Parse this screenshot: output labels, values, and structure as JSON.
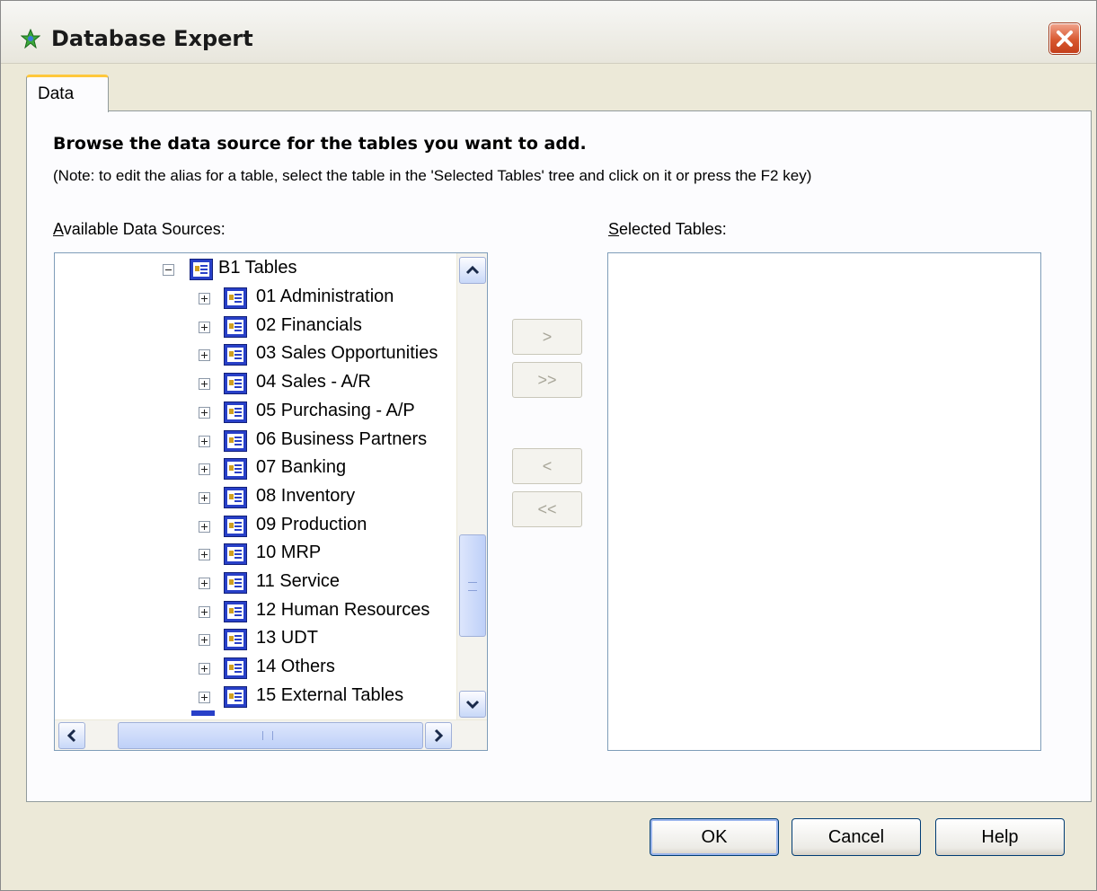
{
  "window": {
    "title": "Database Expert",
    "close_icon": "close-icon"
  },
  "tabs": [
    {
      "label": "Data",
      "active": true
    }
  ],
  "main": {
    "heading": "Browse the data source for the tables you want to add.",
    "note": "(Note: to edit the alias for a table, select the table in the 'Selected Tables' tree and click on it or press the F2 key)"
  },
  "available": {
    "label_accel": "A",
    "label_rest": "vailable Data Sources:",
    "root": {
      "label": "B1 Tables",
      "expanded": true
    },
    "items": [
      {
        "label": "01 Administration"
      },
      {
        "label": "02 Financials"
      },
      {
        "label": "03 Sales Opportunities"
      },
      {
        "label": "04 Sales - A/R"
      },
      {
        "label": "05 Purchasing - A/P"
      },
      {
        "label": "06 Business Partners"
      },
      {
        "label": "07 Banking"
      },
      {
        "label": "08 Inventory"
      },
      {
        "label": "09 Production"
      },
      {
        "label": "10 MRP"
      },
      {
        "label": "11 Service"
      },
      {
        "label": "12 Human Resources"
      },
      {
        "label": "13 UDT"
      },
      {
        "label": "14 Others"
      },
      {
        "label": "15 External Tables"
      }
    ]
  },
  "move_buttons": {
    "add_one": ">",
    "add_all": ">>",
    "remove_one": "<",
    "remove_all": "<<"
  },
  "selected": {
    "label_accel": "S",
    "label_rest": "elected Tables:"
  },
  "footer": {
    "ok": "OK",
    "cancel": "Cancel",
    "help": "Help"
  },
  "colors": {
    "dialog_bg": "#ece9d8",
    "tab_accent": "#ffc83c",
    "close_button": "#d8572f",
    "button_border": "#003c74"
  }
}
